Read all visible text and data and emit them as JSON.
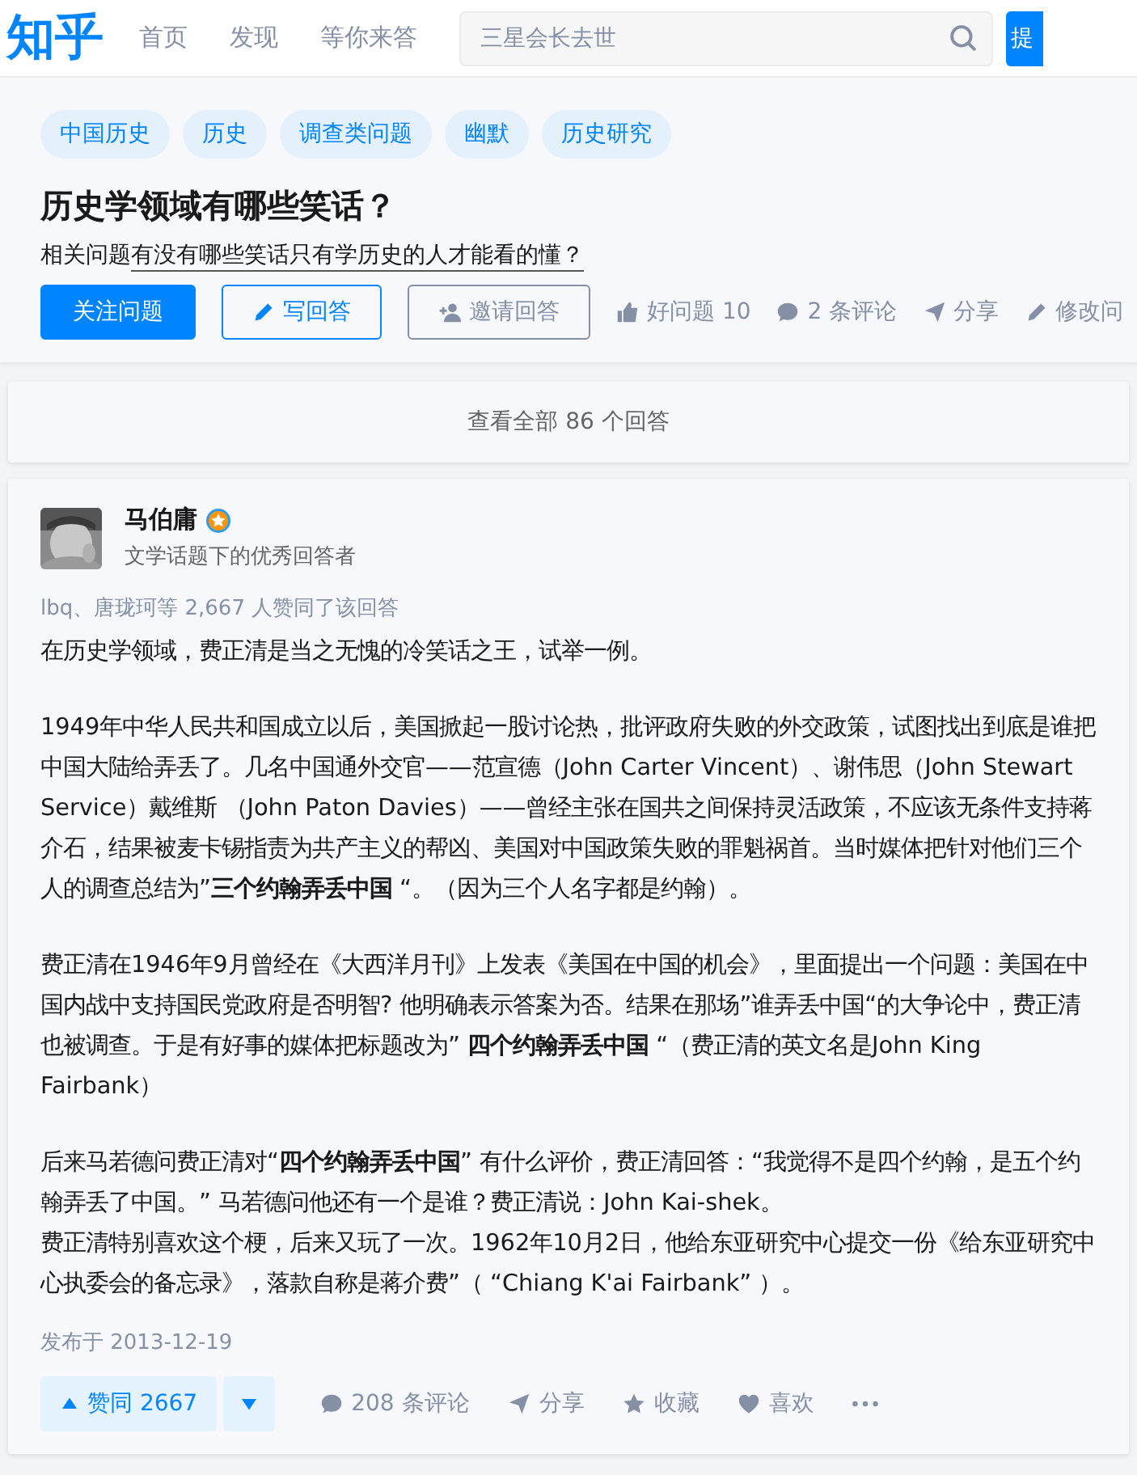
{
  "header": {
    "logo": "知乎",
    "nav": [
      {
        "label": "首页",
        "selected": false
      },
      {
        "label": "发现",
        "selected": false
      },
      {
        "label": "等你来答",
        "selected": false
      }
    ],
    "search": {
      "placeholder": "三星会长去世"
    },
    "ask_button": "提"
  },
  "question": {
    "topics": [
      "中国历史",
      "历史",
      "调查类问题",
      "幽默",
      "历史研究"
    ],
    "title": "历史学领域有哪些笑话？",
    "related_label": "相关问题",
    "related_link": "有没有哪些笑话只有学历史的人才能看的懂？",
    "buttons": [
      {
        "kind": "primary",
        "label": "关注问题"
      },
      {
        "kind": "write",
        "label": "写回答"
      },
      {
        "kind": "invite",
        "label": "邀请回答"
      }
    ],
    "actions": [
      {
        "kind": "like",
        "label": "好问题 10"
      },
      {
        "kind": "comment",
        "label": "2 条评论"
      },
      {
        "kind": "share",
        "label": "分享"
      },
      {
        "kind": "edit",
        "label": "修改问"
      }
    ]
  },
  "all_answers": "查看全部 86 个回答",
  "answer": {
    "author": "马伯庸",
    "headline": "文学话题下的优秀回答者",
    "votes_summary": "lbq、唐珑珂等 2,667 人赞同了该回答",
    "blocks": [
      [
        "在历史学领域，费正清是当之无愧的冷笑话之王，试举一例。"
      ],
      [
        "1949年中华人民共和国成立以后，美国掀起一股讨论热，批评政府失败的外交政策，试图找出到底是谁把中国大陆给弄丢了。几名中国通外交官——范宣德（John Carter Vincent）、谢伟思（John Stewart Service）戴维斯 （John Paton Davies）——曾经主张在国共之间保持灵活政策，不应该无条件支持蒋介石，结果被麦卡锡指责为共产主义的帮凶、美国对中国政策失败的罪魁祸首。当时媒体把针对他们三个人的调查总结为”**三个约翰弄丢中国** “。（因为三个人名字都是约翰）。"
      ],
      [
        "费正清在1946年9月曾经在《大西洋月刊》上发表《美国在中国的机会》，里面提出一个问题：美国在中国内战中支持国民党政府是否明智? 他明确表示答案为否。结果在那场”谁弄丢中国“的大争论中，费正清也被调查。于是有好事的媒体把标题改为” **四个约翰弄丢中国** “（费正清的英文名是John King Fairbank）"
      ],
      [
        "后来马若德问费正清对“**四个约翰弄丢中国**” 有什么评价，费正清回答：“我觉得不是四个约翰，是五个约翰弄丢了中国。” 马若德问他还有一个是谁？费正清说：John Kai-shek。",
        "费正清特别喜欢这个梗，后来又玩了一次。1962年10月2日，他给东亚研究中心提交一份《给东亚研究中心执委会的备忘录》，落款自称是蒋介费”（ “Chiang K'ai Fairbank” ）。"
      ]
    ],
    "date": "发布于 2013-12-19",
    "vote": "赞同 2667",
    "actions": [
      {
        "kind": "comment",
        "label": "208 条评论"
      },
      {
        "kind": "share",
        "label": "分享"
      },
      {
        "kind": "collect",
        "label": "收藏"
      },
      {
        "kind": "love",
        "label": "喜欢"
      },
      {
        "kind": "more"
      }
    ]
  }
}
